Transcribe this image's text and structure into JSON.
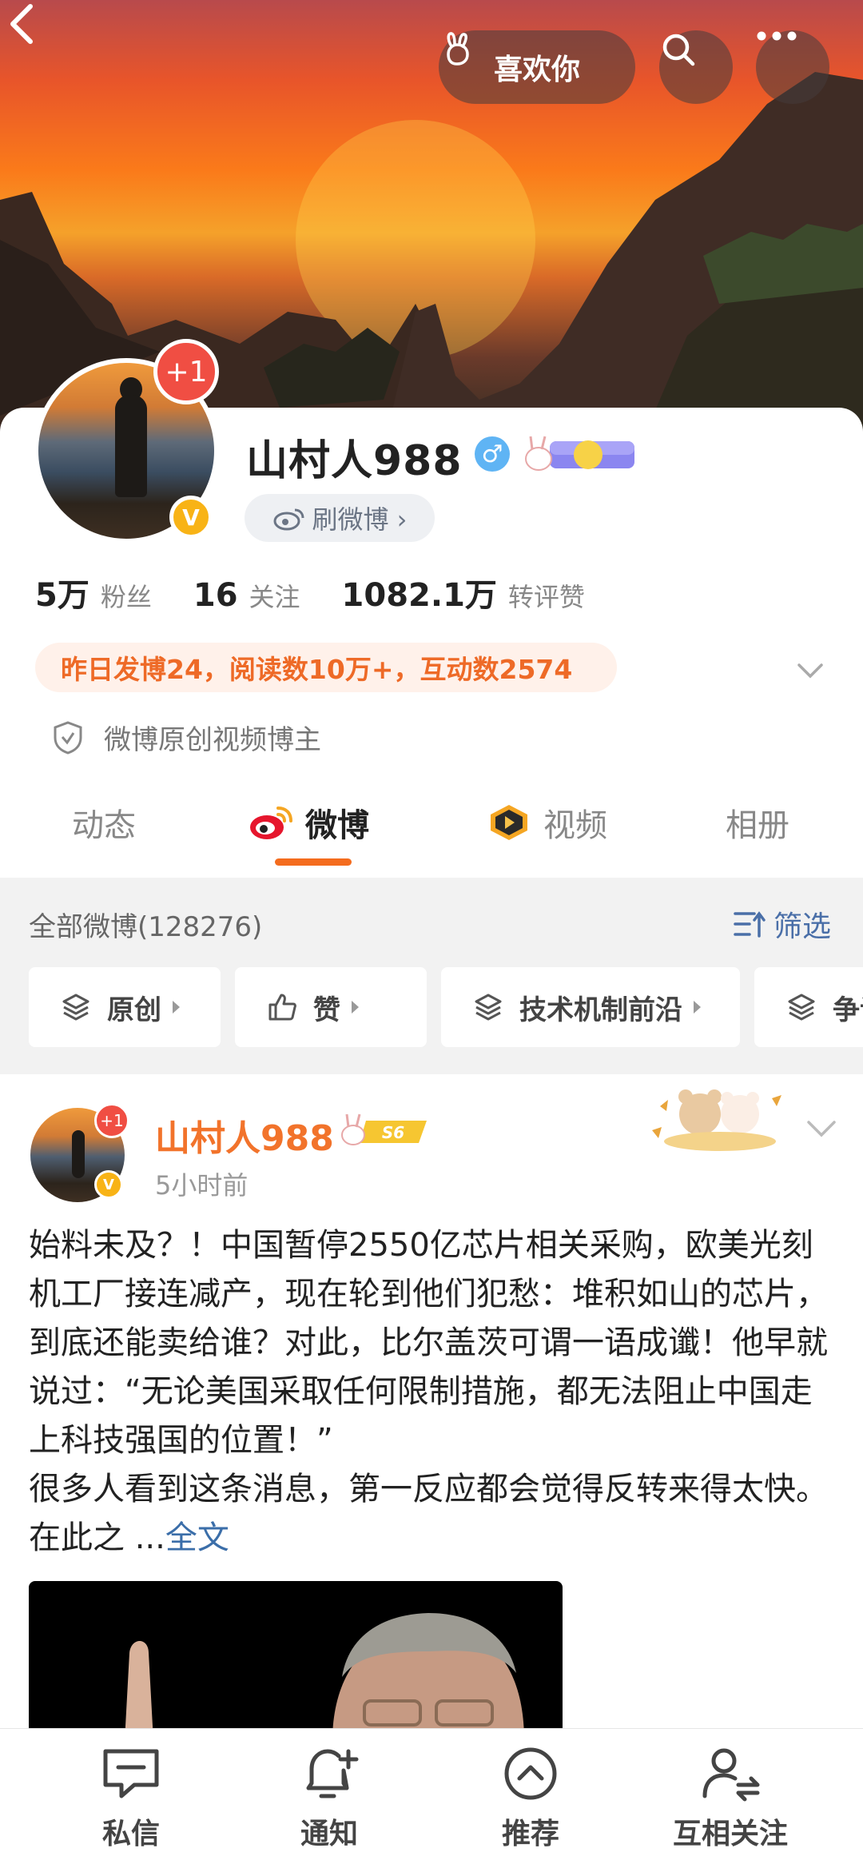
{
  "header": {
    "like_label": "喜欢你"
  },
  "profile": {
    "name": "山村人988",
    "gender_symbol": "♂",
    "avatar_badge": "+1",
    "verified_mark": "V",
    "shua_label": "刷微博 ›",
    "stats": [
      {
        "value": "5万",
        "label": "粉丝"
      },
      {
        "value": "16",
        "label": "关注"
      },
      {
        "value": "1082.1万",
        "label": "转评赞"
      }
    ],
    "highlight": "昨日发博24，阅读数10万+，互动数2574",
    "origin_tag": "微博原创视频博主"
  },
  "tabs": [
    {
      "label": "动态"
    },
    {
      "label": "微博"
    },
    {
      "label": "视频"
    },
    {
      "label": "相册"
    }
  ],
  "feed": {
    "all_label": "全部微博(128276)",
    "filter_label": "筛选",
    "chips": [
      {
        "label": "原创"
      },
      {
        "label": "赞"
      },
      {
        "label": "技术机制前沿"
      },
      {
        "label": "争议"
      }
    ]
  },
  "post": {
    "author": "山村人988",
    "avatar_badge": "+1",
    "verified_mark": "V",
    "level": "S6",
    "time": "5小时前",
    "text": "始料未及？！中国暂停2550亿芯片相关采购，欧美光刻机工厂接连减产，现在轮到他们犯愁：堆积如山的芯片，到底还能卖给谁？对此，比尔盖茨可谓一语成谶！他早就说过：“无论美国采取任何限制措施，都无法阻止中国走上科技强国的位置！”",
    "text2": "很多人看到这条消息，第一反应都会觉得反转来得太快。在此之 ...",
    "full_label": "全文"
  },
  "bottom_nav": [
    {
      "label": "私信",
      "icon": "message-icon"
    },
    {
      "label": "通知",
      "icon": "bell-plus-icon"
    },
    {
      "label": "推荐",
      "icon": "recommend-icon"
    },
    {
      "label": "互相关注",
      "icon": "mutual-follow-icon"
    }
  ],
  "colors": {
    "accent_orange": "#f46c1e",
    "name_orange": "#f2732b",
    "link_blue": "#3b6ea9",
    "verified_gold": "#f8b316",
    "badge_red": "#f04e43"
  }
}
